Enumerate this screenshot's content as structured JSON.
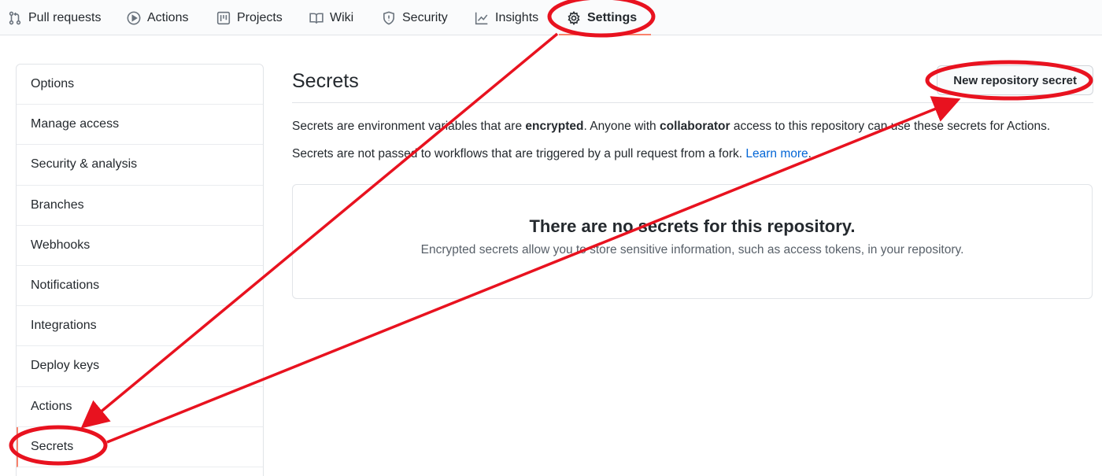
{
  "topnav": {
    "tabs": [
      {
        "label": "Pull requests",
        "icon": "git-pull-request-icon"
      },
      {
        "label": "Actions",
        "icon": "play-icon"
      },
      {
        "label": "Projects",
        "icon": "project-icon"
      },
      {
        "label": "Wiki",
        "icon": "book-icon"
      },
      {
        "label": "Security",
        "icon": "shield-icon"
      },
      {
        "label": "Insights",
        "icon": "graph-icon"
      },
      {
        "label": "Settings",
        "icon": "gear-icon",
        "selected": true
      }
    ]
  },
  "sidebar": {
    "items": [
      {
        "label": "Options"
      },
      {
        "label": "Manage access"
      },
      {
        "label": "Security & analysis"
      },
      {
        "label": "Branches"
      },
      {
        "label": "Webhooks"
      },
      {
        "label": "Notifications"
      },
      {
        "label": "Integrations"
      },
      {
        "label": "Deploy keys"
      },
      {
        "label": "Actions"
      },
      {
        "label": "Secrets",
        "selected": true
      }
    ]
  },
  "main": {
    "title": "Secrets",
    "new_button_label": "New repository secret",
    "description_1": {
      "part1": "Secrets are environment variables that are ",
      "bold1": "encrypted",
      "part2": ". Anyone with ",
      "bold2": "collaborator",
      "part3": " access to this repository can use these secrets for Actions."
    },
    "description_2": {
      "text": "Secrets are not passed to workflows that are triggered by a pull request from a fork. ",
      "link": "Learn more",
      "end": "."
    },
    "blankslate": {
      "heading": "There are no secrets for this repository.",
      "text": "Encrypted secrets allow you to store sensitive information, such as access tokens, in your repository."
    }
  },
  "annotation": {
    "color": "#e8121f"
  }
}
